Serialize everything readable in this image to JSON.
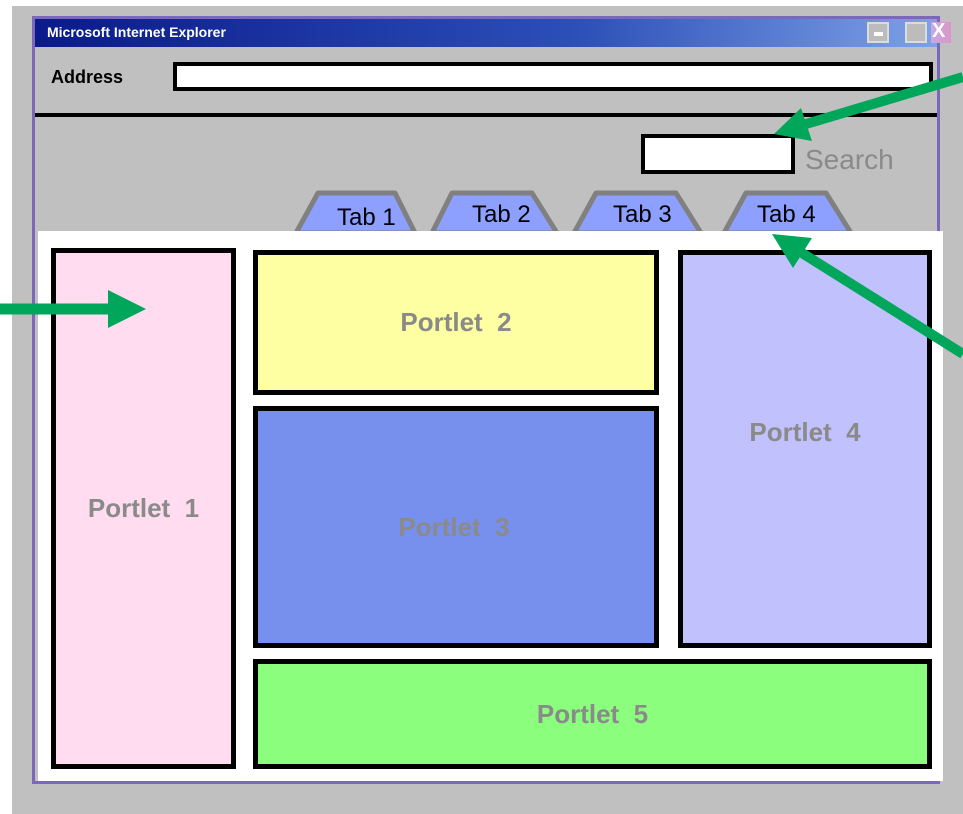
{
  "window": {
    "title": "Microsoft  Internet  Explorer",
    "close_glyph": "X"
  },
  "address": {
    "label": "Address",
    "value": ""
  },
  "search": {
    "value": "",
    "label": "Search"
  },
  "tabs": [
    {
      "label": "Tab 1"
    },
    {
      "label": "Tab 2"
    },
    {
      "label": "Tab 3"
    },
    {
      "label": "Tab 4"
    }
  ],
  "portlets": [
    {
      "label": "Portlet  1",
      "color": "#ffdcef"
    },
    {
      "label": "Portlet  2",
      "color": "#fefea2"
    },
    {
      "label": "Portlet  3",
      "color": "#7790ed"
    },
    {
      "label": "Portlet  4",
      "color": "#c1c1fe"
    },
    {
      "label": "Portlet  5",
      "color": "#8cfe7e"
    }
  ],
  "colors": {
    "tab_fill": "#8da0ff",
    "arrow": "#00a65a",
    "frame": "#7b68b8"
  }
}
